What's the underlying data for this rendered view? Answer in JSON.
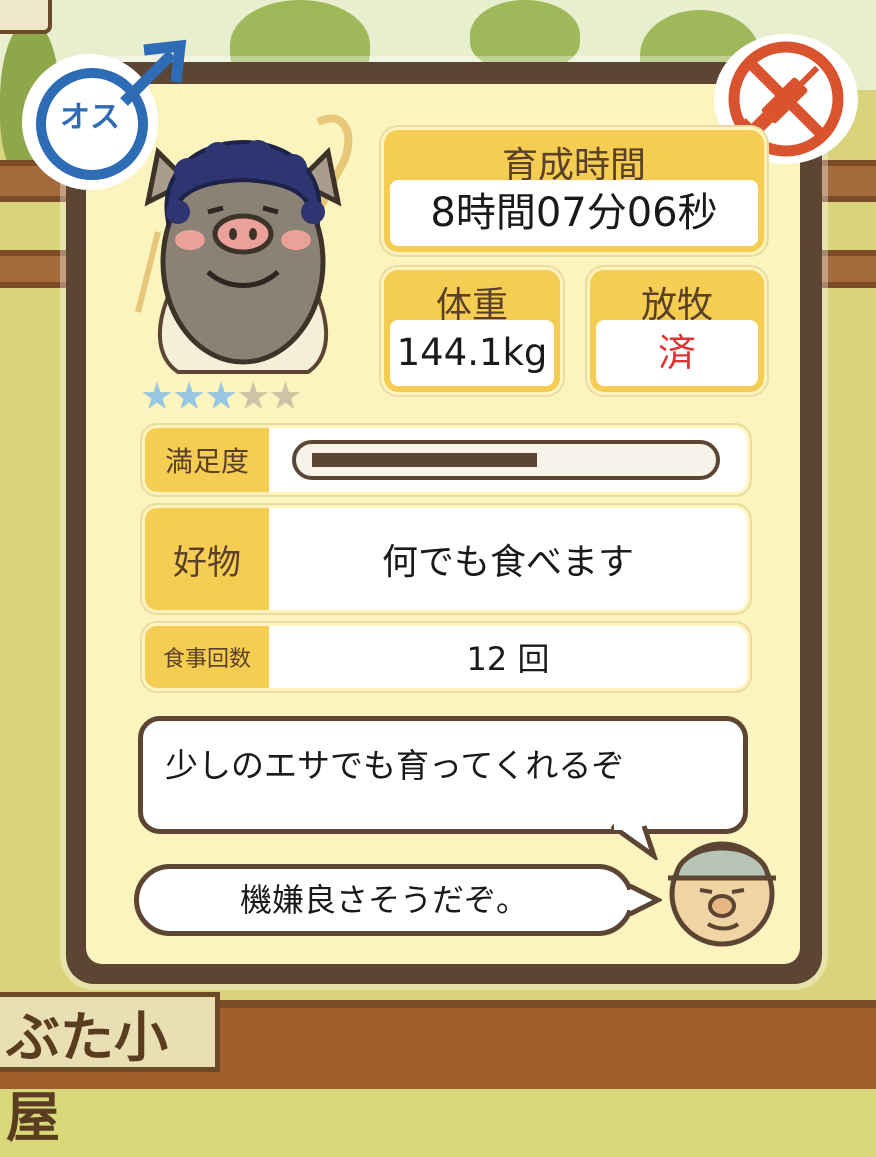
{
  "background_sign": "ぶた小屋",
  "gender": {
    "label": "オス",
    "color": "#2e6cb5"
  },
  "vaccine": {
    "icon": "syringe-prohibited-icon",
    "color": "#d9532e"
  },
  "rating": {
    "stars": 3,
    "max": 5
  },
  "growth_time": {
    "label": "育成時間",
    "value": "8時間07分06秒"
  },
  "weight": {
    "label": "体重",
    "value": "144.1kg"
  },
  "grazing": {
    "label": "放牧",
    "value": "済",
    "value_color": "#e03333"
  },
  "satisfaction": {
    "label": "満足度",
    "level": 0.58
  },
  "favorite_food": {
    "label": "好物",
    "value": "何でも食べます"
  },
  "meal_count": {
    "label": "食事回数",
    "value": "12 回"
  },
  "message": "少しのエサでも育ってくれるぞ",
  "mood": "機嫌良さそうだぞ。",
  "colors": {
    "panel_border": "#5c4633",
    "header_yellow": "#f4cd52",
    "panel_bg": "#fbf4bf"
  }
}
